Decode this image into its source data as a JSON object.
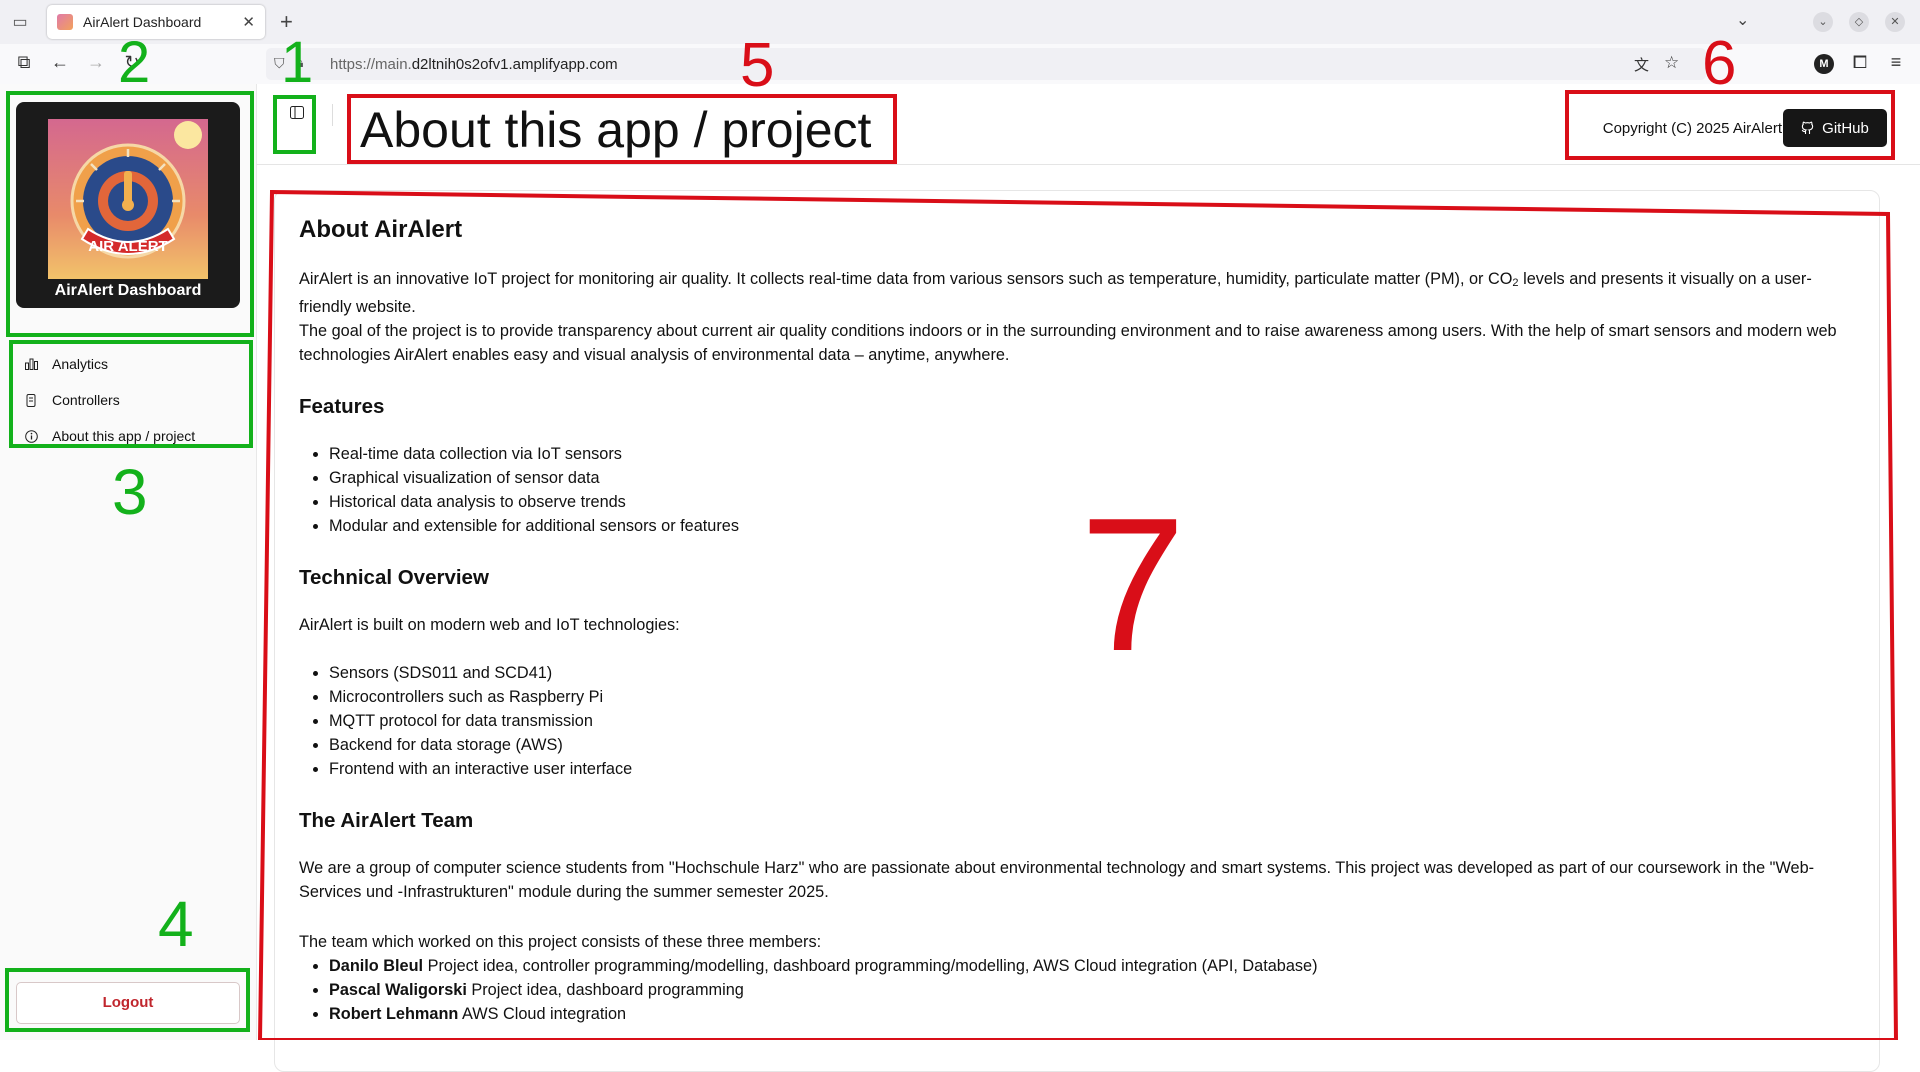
{
  "browser": {
    "tab_title": "AirAlert Dashboard",
    "url_prefix": "https://main.",
    "url_domain": "d2ltnih0s2ofv1.amplifyapp.com",
    "account_initial": "M"
  },
  "sidebar": {
    "brand_title": "AirAlert Dashboard",
    "logo_text": "AIR ALERT",
    "items": [
      {
        "label": "Analytics",
        "icon": "bar-chart-icon"
      },
      {
        "label": "Controllers",
        "icon": "device-icon"
      },
      {
        "label": "About this app / project",
        "icon": "info-icon"
      }
    ],
    "logout_label": "Logout"
  },
  "header": {
    "title": "About this app / project",
    "copyright": "Copyright (C) 2025 AirAlert",
    "github_label": "GitHub"
  },
  "content": {
    "about_heading": "About AirAlert",
    "about_p1_before": "AirAlert is an innovative IoT project for monitoring air quality. It collects real-time data from various sensors such as temperature, humidity, particulate matter (PM), or CO",
    "about_p1_sub": "2",
    "about_p1_after": " levels and presents it visually on a user-friendly website.",
    "about_p2": "The goal of the project is to provide transparency about current air quality conditions indoors or in the surrounding environment and to raise awareness among users. With the help of smart sensors and modern web technologies AirAlert enables easy and visual analysis of environmental data – anytime, anywhere.",
    "features_heading": "Features",
    "features": [
      "Real-time data collection via IoT sensors",
      "Graphical visualization of sensor data",
      "Historical data analysis to observe trends",
      "Modular and extensible for additional sensors or features"
    ],
    "tech_heading": "Technical Overview",
    "tech_intro": "AirAlert is built on modern web and IoT technologies:",
    "tech": [
      "Sensors (SDS011 and SCD41)",
      "Microcontrollers such as Raspberry Pi",
      "MQTT protocol for data transmission",
      "Backend for data storage (AWS)",
      "Frontend with an interactive user interface"
    ],
    "team_heading": "The AirAlert Team",
    "team_intro": "We are a group of computer science students from \"Hochschule Harz\" who are passionate about environmental technology and smart systems. This project was developed as part of our coursework in the \"Web-Services und -Infrastrukturen\" module during the summer semester 2025.",
    "team_members_intro": "The team which worked on this project consists of these three members:",
    "members": [
      {
        "name": "Danilo Bleul",
        "role": "Project idea, controller programming/modelling, dashboard programming/modelling, AWS Cloud integration (API, Database)"
      },
      {
        "name": "Pascal Waligorski",
        "role": "Project idea, dashboard programming"
      },
      {
        "name": "Robert Lehmann",
        "role": "AWS Cloud integration"
      }
    ]
  },
  "annotations": [
    "1",
    "2",
    "3",
    "4",
    "5",
    "6",
    "7"
  ]
}
